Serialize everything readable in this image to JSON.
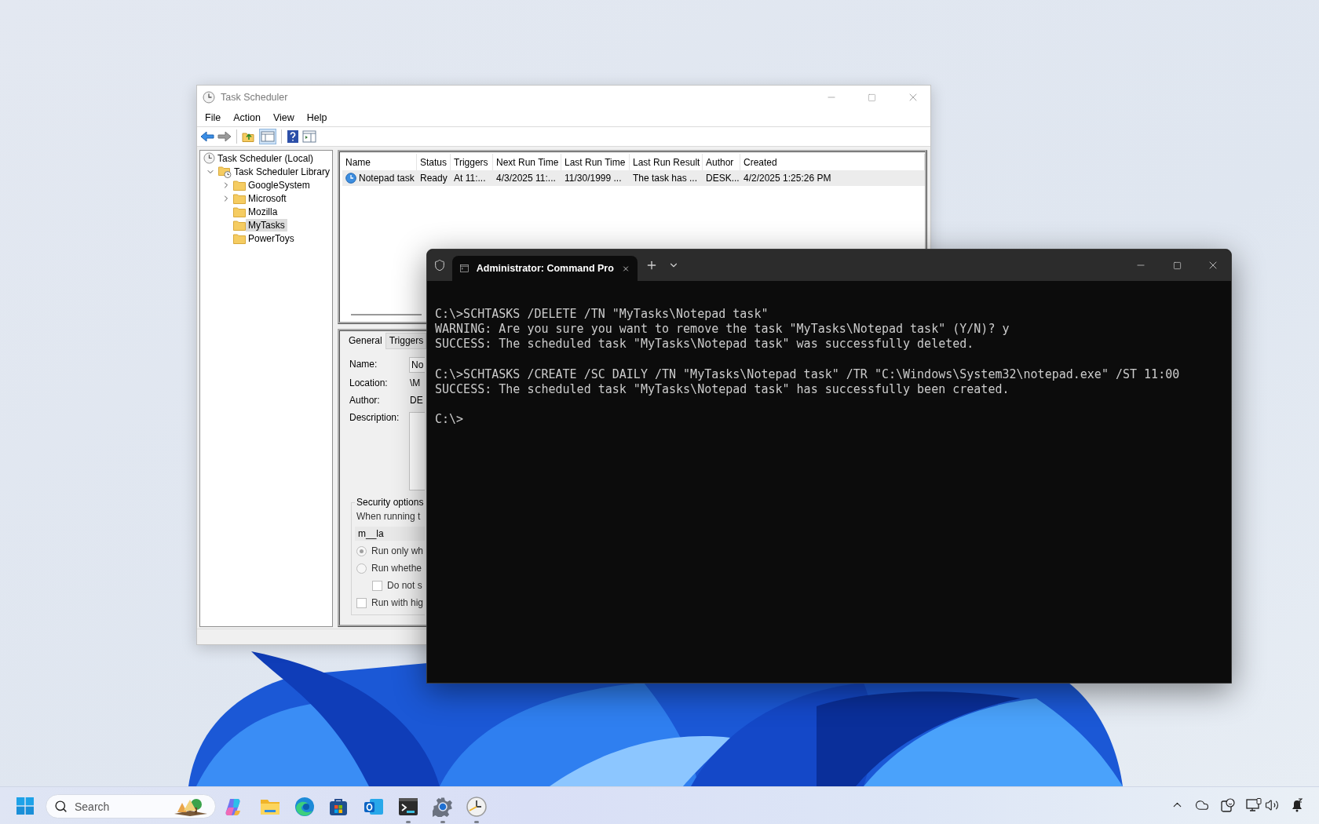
{
  "task_scheduler": {
    "title": "Task Scheduler",
    "menu": [
      "File",
      "Action",
      "View",
      "Help"
    ],
    "tree": [
      {
        "kind": "clock",
        "label": "Task Scheduler (Local)",
        "selected": false,
        "children": [
          {
            "kind": "library",
            "label": "Task Scheduler Library",
            "selected": false,
            "expanded": true,
            "children": [
              {
                "kind": "folder",
                "label": "GoogleSystem",
                "selected": false,
                "expanded": false
              },
              {
                "kind": "folder",
                "label": "Microsoft",
                "selected": false,
                "expanded": false
              },
              {
                "kind": "folder",
                "label": "Mozilla",
                "selected": false
              },
              {
                "kind": "folder",
                "label": "MyTasks",
                "selected": true
              },
              {
                "kind": "folder",
                "label": "PowerToys",
                "selected": false
              }
            ]
          }
        ]
      }
    ],
    "table": {
      "columns": [
        "Name",
        "Status",
        "Triggers",
        "Next Run Time",
        "Last Run Time",
        "Last Run Result",
        "Author",
        "Created"
      ],
      "rows": [
        {
          "selected": true,
          "cells": [
            "Notepad task",
            "Ready",
            "At 11:...",
            "4/3/2025 11:...",
            "11/30/1999 ...",
            "The task has ...",
            "DESK...",
            "4/2/2025 1:25:26 PM"
          ]
        }
      ]
    },
    "details": {
      "tabs": [
        {
          "label": "General",
          "selected": true
        },
        {
          "label": "Triggers",
          "selected": false
        }
      ],
      "fields": [
        {
          "kind": "input",
          "label": "Name:",
          "value": "No"
        },
        {
          "kind": "text",
          "label": "Location:",
          "value": "\\M"
        },
        {
          "kind": "text",
          "label": "Author:",
          "value": "DE"
        },
        {
          "kind": "textarea",
          "label": "Description:"
        }
      ],
      "security": {
        "title": "Security options",
        "prompt": "When running t",
        "account": "m__la",
        "options": [
          {
            "kind": "radio",
            "label": "Run only wh",
            "selected": true
          },
          {
            "kind": "radio",
            "label": "Run whethe",
            "selected": false,
            "children": [
              {
                "kind": "checkbox",
                "label": "Do not s",
                "checked": false
              }
            ]
          },
          {
            "kind": "checkbox",
            "label": "Run with hig",
            "checked": false
          }
        ]
      }
    }
  },
  "terminal": {
    "tab_title": "Administrator: Command Pro",
    "blocks": [
      [
        "C:\\>SCHTASKS /DELETE /TN \"MyTasks\\Notepad task\"",
        "WARNING: Are you sure you want to remove the task \"MyTasks\\Notepad task\" (Y/N)? y",
        "SUCCESS: The scheduled task \"MyTasks\\Notepad task\" was successfully deleted."
      ],
      [
        "C:\\>SCHTASKS /CREATE /SC DAILY /TN \"MyTasks\\Notepad task\" /TR \"C:\\Windows\\System32\\notepad.exe\" /ST 11:00",
        "SUCCESS: The scheduled task \"MyTasks\\Notepad task\" has successfully been created."
      ],
      [
        "C:\\>"
      ]
    ]
  },
  "taskbar": {
    "search": {
      "placeholder": "Search"
    },
    "apps": [
      {
        "kind": "copilot",
        "running": false
      },
      {
        "kind": "explorer",
        "running": false
      },
      {
        "kind": "edge",
        "running": false
      },
      {
        "kind": "store",
        "running": false
      },
      {
        "kind": "outlook",
        "running": false
      },
      {
        "kind": "terminal",
        "running": true
      },
      {
        "kind": "settings",
        "running": true
      },
      {
        "kind": "scheduler",
        "running": true
      }
    ]
  }
}
